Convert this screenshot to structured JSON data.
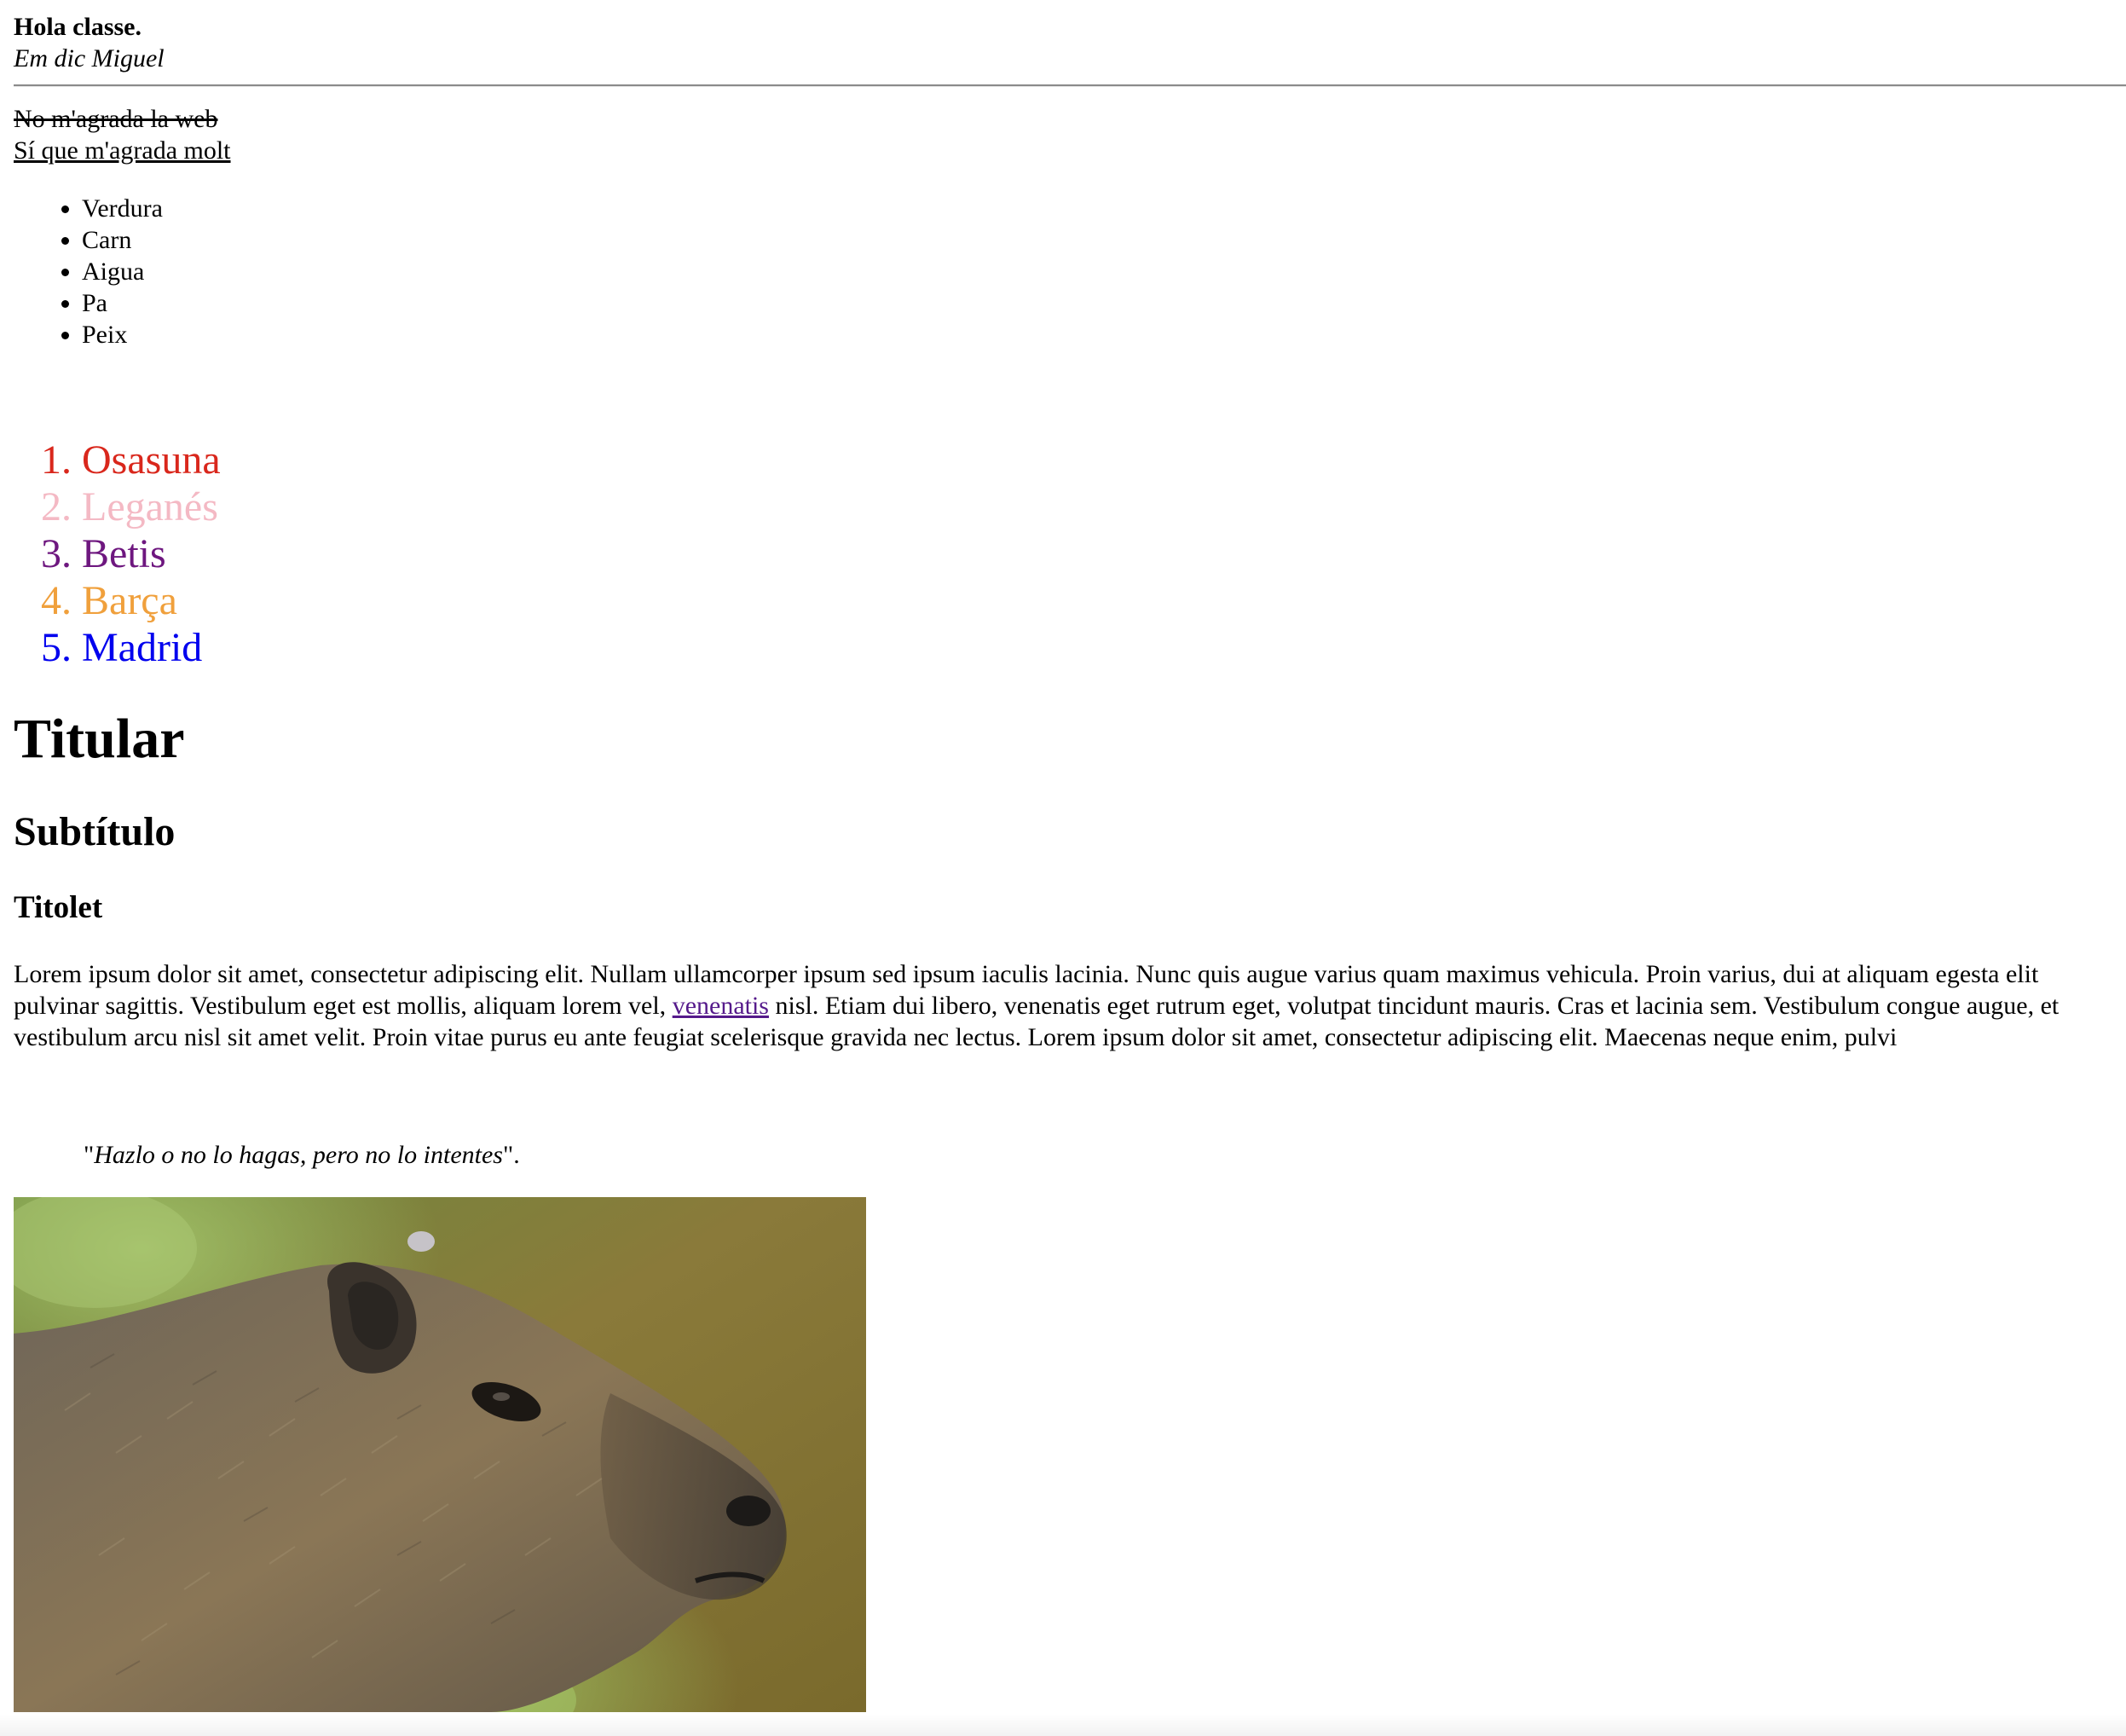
{
  "intro": {
    "greeting": "Hola classe.",
    "name": "Em dic Miguel"
  },
  "opinion": {
    "struck": "No m'agrada la web",
    "underlined": "Sí que m'agrada molt"
  },
  "food_list": [
    "Verdura",
    "Carn",
    "Aigua",
    "Pa",
    "Peix"
  ],
  "teams": [
    {
      "label": "Osasuna",
      "color": "#d9271c"
    },
    {
      "label": "Leganés",
      "color": "#f4b9c4"
    },
    {
      "label": "Betis",
      "color": "#6e177f"
    },
    {
      "label": "Barça",
      "color": "#f0a03c"
    },
    {
      "label": "Madrid",
      "color": "#0000ee"
    }
  ],
  "headings": {
    "h1": "Titular",
    "h2": "Subtítulo",
    "h3": "Titolet"
  },
  "paragraph": {
    "before_link": "Lorem ipsum dolor sit amet, consectetur adipiscing elit. Nullam ullamcorper ipsum sed ipsum iaculis lacinia. Nunc quis augue varius quam maximus vehicula. Proin varius, dui at aliquam egesta elit pulvinar sagittis. Vestibulum eget est mollis, aliquam lorem vel, ",
    "link": "venenatis",
    "after_link": " nisl. Etiam dui libero, venenatis eget rutrum eget, volutpat tincidunt mauris. Cras et lacinia sem. Vestibulum congue augue, et vestibulum arcu nisl sit amet velit. Proin vitae purus eu ante feugiat scelerisque gravida nec lectus. Lorem ipsum dolor sit amet, consectetur adipiscing elit. Maecenas neque enim, pulvi"
  },
  "quote": {
    "open_mark": "\"",
    "text": "Hazlo o no lo hagas, pero no lo intentes",
    "close_mark": "\"."
  },
  "image": {
    "subject": "capybara"
  }
}
